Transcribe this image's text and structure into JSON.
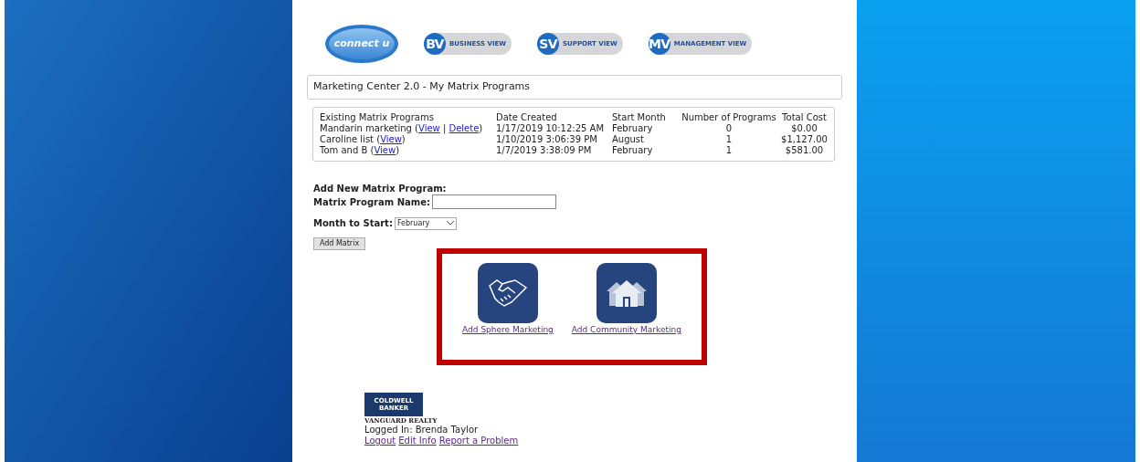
{
  "header": {
    "logo": {
      "brand": "connect u"
    },
    "view_buttons": [
      {
        "badge": "BV",
        "label": "BUSINESS VIEW"
      },
      {
        "badge": "SV",
        "label": "SUPPORT VIEW"
      },
      {
        "badge": "MV",
        "label": "MANAGEMENT VIEW"
      }
    ]
  },
  "page_title": "Marketing Center 2.0 - My Matrix Programs",
  "programs_table": {
    "columns": [
      "Existing Matrix Programs",
      "Date Created",
      "Start Month",
      "Number of Programs",
      "Total Cost"
    ],
    "rows": [
      {
        "name": [
          {
            "kind": "text",
            "text": "Mandarin marketing ("
          },
          {
            "kind": "link",
            "text": "View"
          },
          {
            "kind": "text",
            "text": " | "
          },
          {
            "kind": "link",
            "text": "Delete"
          },
          {
            "kind": "text",
            "text": ")"
          }
        ],
        "date_created": "1/17/2019 10:12:25 AM",
        "start_month": "February",
        "number_of_programs": "0",
        "total_cost": "$0.00"
      },
      {
        "name": [
          {
            "kind": "text",
            "text": "Caroline list ("
          },
          {
            "kind": "link",
            "text": "View"
          },
          {
            "kind": "text",
            "text": ")"
          }
        ],
        "date_created": "1/10/2019 3:06:39 PM",
        "start_month": "August",
        "number_of_programs": "1",
        "total_cost": "$1,127.00"
      },
      {
        "name": [
          {
            "kind": "text",
            "text": "Tom and B ("
          },
          {
            "kind": "link",
            "text": "View"
          },
          {
            "kind": "text",
            "text": ")"
          }
        ],
        "date_created": "1/7/2019 3:38:09 PM",
        "start_month": "February",
        "number_of_programs": "1",
        "total_cost": "$581.00"
      }
    ]
  },
  "add_form": {
    "heading": "Add New Matrix Program:",
    "name_label": "Matrix Program Name:",
    "month_label": "Month to Start:",
    "month_value": "February",
    "submit": "Add Matrix"
  },
  "marketing_options": [
    {
      "kind": "handshake",
      "label": "Add Sphere Marketing"
    },
    {
      "kind": "houses",
      "label": "Add Community Marketing"
    }
  ],
  "footer": {
    "company_logo": {
      "line1": "COLDWELL",
      "line2": "BANKER",
      "subtitle": "VANGUARD REALTY"
    },
    "logged_in": "Logged In: Brenda Taylor",
    "links": [
      "Logout",
      "Edit Info",
      "Report a Problem"
    ]
  }
}
